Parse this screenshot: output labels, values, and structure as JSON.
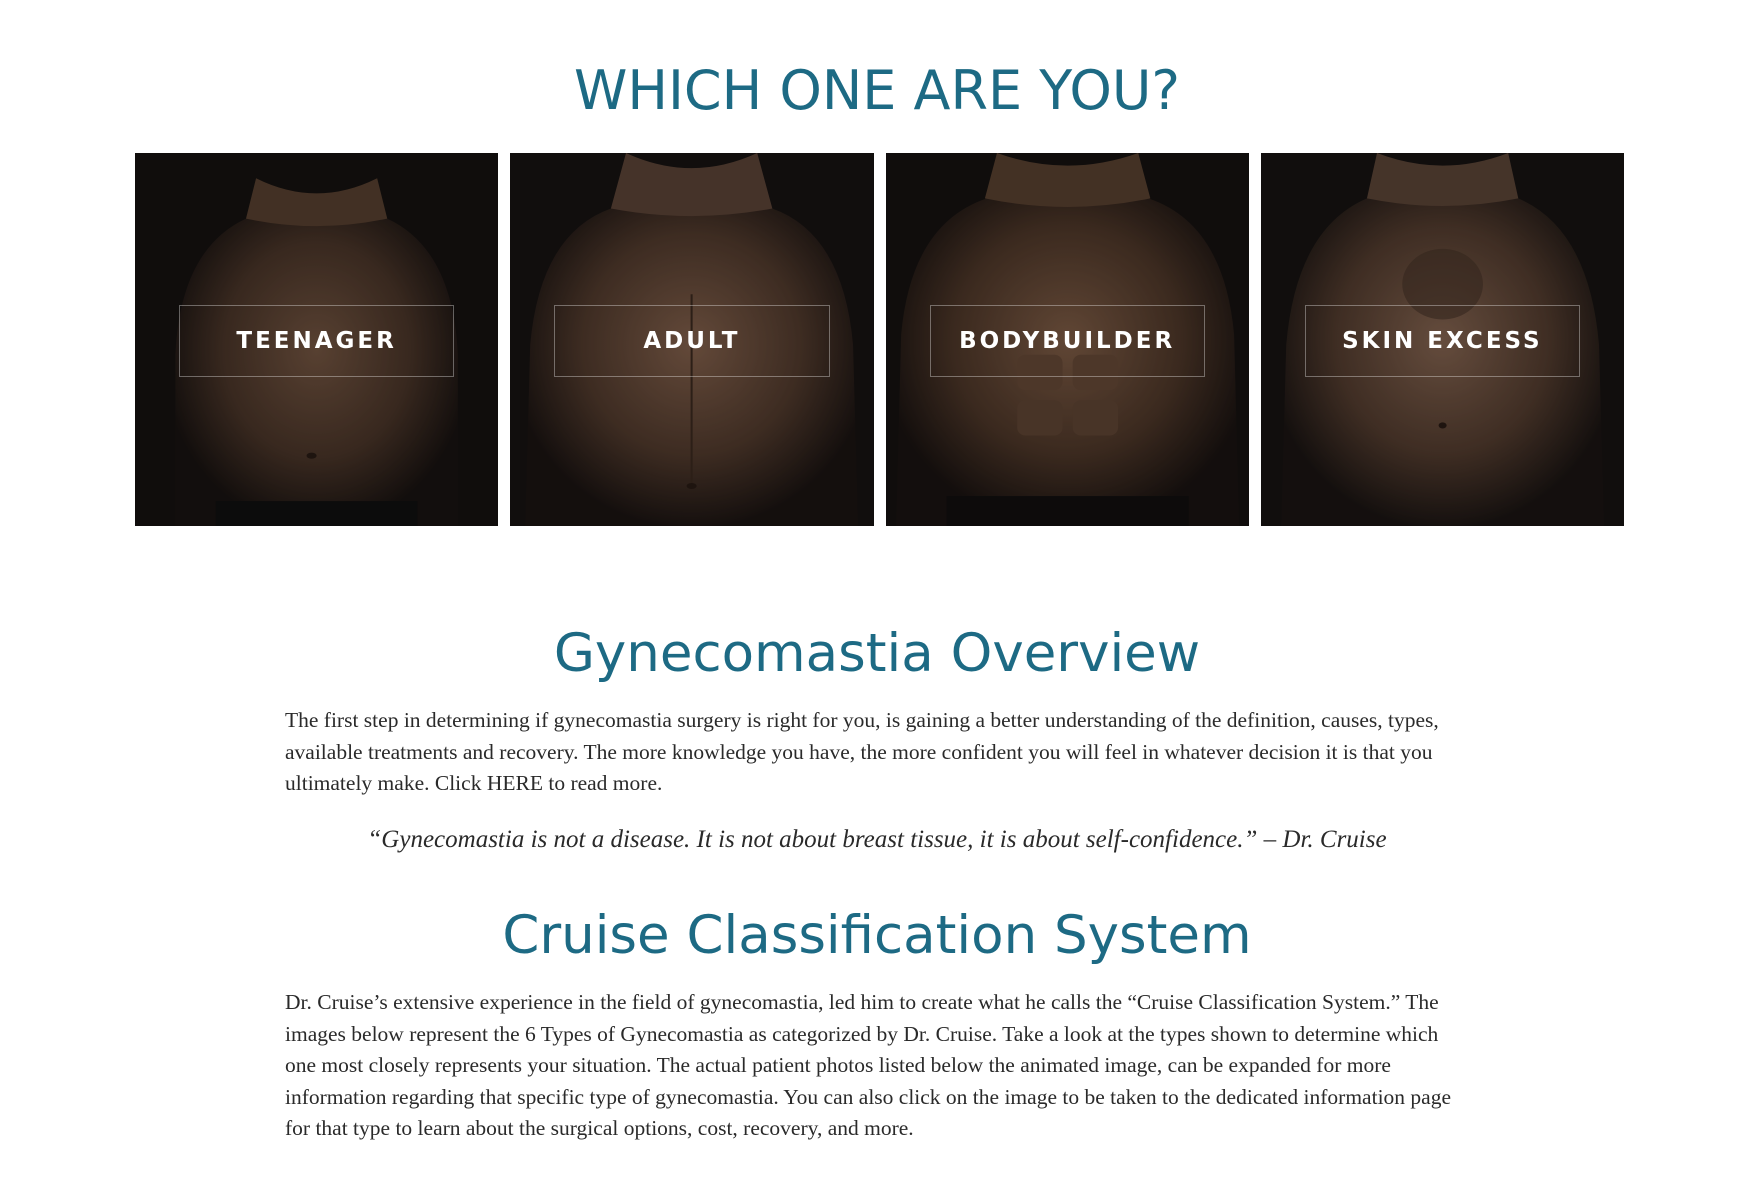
{
  "which_section": {
    "title": "WHICH ONE ARE YOU?",
    "cards": [
      {
        "label": "TEENAGER"
      },
      {
        "label": "ADULT"
      },
      {
        "label": "BODYBUILDER"
      },
      {
        "label": "SKIN EXCESS"
      }
    ]
  },
  "overview": {
    "title": "Gynecomastia Overview",
    "text_before_link": "The first step in determining if gynecomastia surgery is right for you, is gaining a better understanding of the definition, causes, types, available treatments and recovery. The more knowledge you have, the more confident you will feel in whatever decision it is that you ultimately make. Click ",
    "link_text": "HERE",
    "text_after_link": " to read more.",
    "quote": "“Gynecomastia is not a disease. It is not about breast tissue, it is about self-confidence.” – Dr. Cruise"
  },
  "classification": {
    "title": "Cruise Classification System",
    "text": "Dr. Cruise’s extensive experience in the field of gynecomastia, led him to create what he calls the “Cruise Classification System.” The images below represent the 6 Types of Gynecomastia as categorized by Dr. Cruise. Take a look at the types shown to determine which one most closely represents your situation. The actual patient photos listed below the animated image, can be expanded for more information regarding that specific type of gynecomastia. You can also click on the image to be taken to the dedicated information page for that type to learn about the surgical options, cost, recovery, and more."
  },
  "colors": {
    "heading": "#1d6a84",
    "body_text": "#2a2a2a",
    "card_bg": "#161211"
  }
}
